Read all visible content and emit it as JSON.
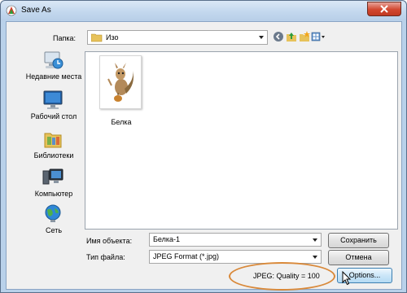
{
  "window": {
    "title": "Save As",
    "accent_color": "#d2472f",
    "frame_color": "#b9d1ea"
  },
  "topbar": {
    "lookin_label": "Папка:",
    "lookin_value": "Изо",
    "buttons": [
      "back-icon",
      "up-folder-icon",
      "new-folder-icon",
      "view-menu-icon"
    ]
  },
  "places": [
    {
      "label": "Недавние места",
      "icon": "recent-places-icon"
    },
    {
      "label": "Рабочий стол",
      "icon": "desktop-icon"
    },
    {
      "label": "Библиотеки",
      "icon": "libraries-icon"
    },
    {
      "label": "Компьютер",
      "icon": "computer-icon"
    },
    {
      "label": "Сеть",
      "icon": "network-icon"
    }
  ],
  "files": [
    {
      "name": "Белка",
      "icon": "squirrel-thumbnail"
    }
  ],
  "form": {
    "filename_label": "Имя объекта:",
    "filename_value": "Белка-1",
    "filetype_label": "Тип файла:",
    "filetype_value": "JPEG Format (*.jpg)"
  },
  "buttons": {
    "save": "Сохранить",
    "cancel": "Отмена",
    "options": "Options..."
  },
  "quality_info": "JPEG: Quality = 100",
  "highlight_color": "#d9893a"
}
